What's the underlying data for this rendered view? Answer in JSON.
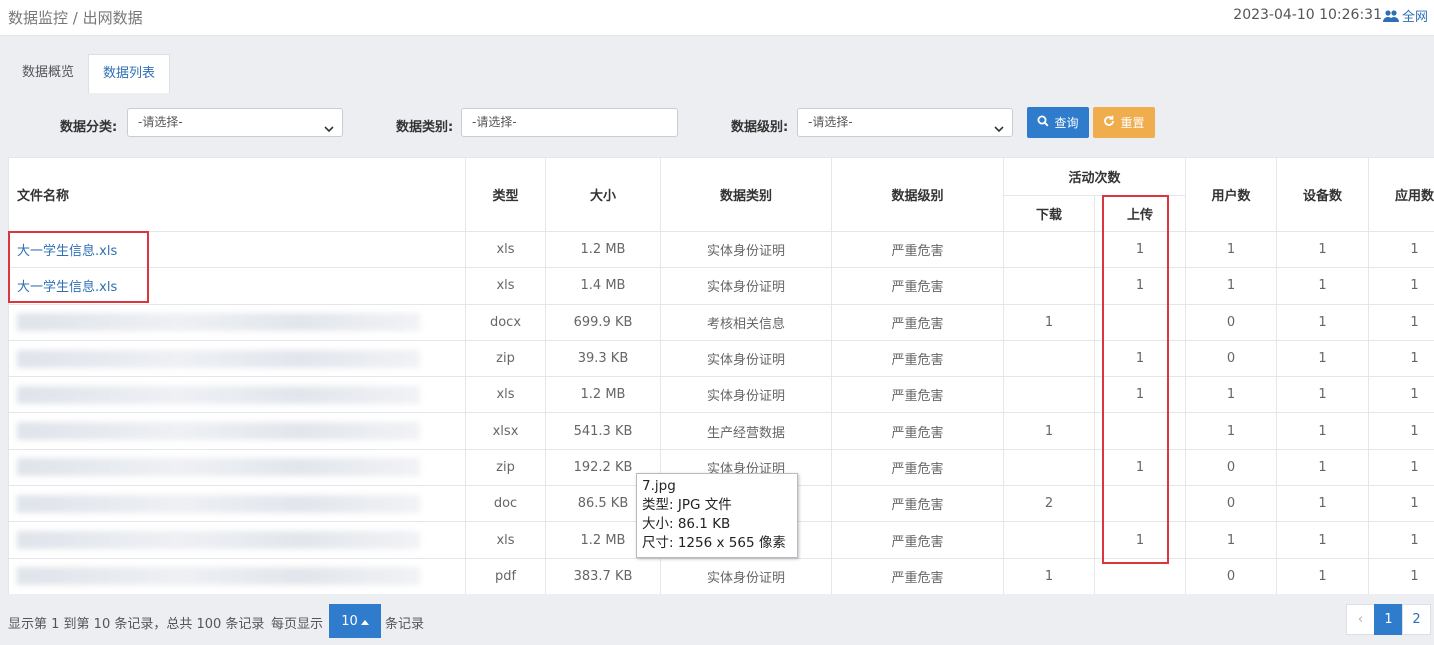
{
  "header": {
    "breadcrumb": "数据监控 / 出网数据",
    "datetime": "2023-04-10 10:26:31",
    "network_label": "全网",
    "network_icon": "users-icon"
  },
  "tabs": [
    {
      "label": "数据概览",
      "active": false
    },
    {
      "label": "数据列表",
      "active": true
    }
  ],
  "filters": {
    "category_label": "数据分类:",
    "category_value": "-请选择-",
    "type_label": "数据类别:",
    "type_placeholder": "-请选择-",
    "level_label": "数据级别:",
    "level_value": "-请选择-",
    "search_label": "查询",
    "reset_label": "重置"
  },
  "table": {
    "headers": {
      "filename": "文件名称",
      "type": "类型",
      "size": "大小",
      "data_category": "数据类别",
      "data_level": "数据级别",
      "activity": "活动次数",
      "download": "下载",
      "upload": "上传",
      "users": "用户数",
      "devices": "设备数",
      "apps": "应用数"
    },
    "rows": [
      {
        "name": "大一学生信息.xls",
        "blurred": false,
        "type": "xls",
        "size": "1.2 MB",
        "category": "实体身份证明",
        "level": "严重危害",
        "download": "",
        "upload": "1",
        "users": "1",
        "devices": "1",
        "apps": "1"
      },
      {
        "name": "大一学生信息.xls",
        "blurred": false,
        "type": "xls",
        "size": "1.4 MB",
        "category": "实体身份证明",
        "level": "严重危害",
        "download": "",
        "upload": "1",
        "users": "1",
        "devices": "1",
        "apps": "1"
      },
      {
        "name": "",
        "blurred": true,
        "type": "docx",
        "size": "699.9 KB",
        "category": "考核相关信息",
        "level": "严重危害",
        "download": "1",
        "upload": "",
        "users": "0",
        "devices": "1",
        "apps": "1"
      },
      {
        "name": "",
        "blurred": true,
        "type": "zip",
        "size": "39.3 KB",
        "category": "实体身份证明",
        "level": "严重危害",
        "download": "",
        "upload": "1",
        "users": "0",
        "devices": "1",
        "apps": "1"
      },
      {
        "name": "",
        "blurred": true,
        "type": "xls",
        "size": "1.2 MB",
        "category": "实体身份证明",
        "level": "严重危害",
        "download": "",
        "upload": "1",
        "users": "1",
        "devices": "1",
        "apps": "1"
      },
      {
        "name": "",
        "blurred": true,
        "type": "xlsx",
        "size": "541.3 KB",
        "category": "生产经营数据",
        "level": "严重危害",
        "download": "1",
        "upload": "",
        "users": "1",
        "devices": "1",
        "apps": "1"
      },
      {
        "name": "",
        "blurred": true,
        "type": "zip",
        "size": "192.2 KB",
        "category": "实体身份证明",
        "level": "严重危害",
        "download": "",
        "upload": "1",
        "users": "0",
        "devices": "1",
        "apps": "1"
      },
      {
        "name": "",
        "blurred": true,
        "type": "doc",
        "size": "86.5 KB",
        "category": "",
        "level": "严重危害",
        "download": "2",
        "upload": "",
        "users": "0",
        "devices": "1",
        "apps": "1"
      },
      {
        "name": "",
        "blurred": true,
        "type": "xls",
        "size": "1.2 MB",
        "category": "",
        "level": "严重危害",
        "download": "",
        "upload": "1",
        "users": "1",
        "devices": "1",
        "apps": "1"
      },
      {
        "name": "",
        "blurred": true,
        "type": "pdf",
        "size": "383.7 KB",
        "category": "实体身份证明",
        "level": "严重危害",
        "download": "1",
        "upload": "",
        "users": "0",
        "devices": "1",
        "apps": "1"
      }
    ]
  },
  "tooltip": {
    "line1": "7.jpg",
    "line2": "类型: JPG 文件",
    "line3": "大小: 86.1 KB",
    "line4": "尺寸: 1256 x 565 像素"
  },
  "footer": {
    "summary": "显示第 1 到第 10 条记录，总共 100 条记录",
    "per_page_prefix": "每页显示",
    "per_page_value": "10",
    "per_page_suffix": "条记录",
    "pages": [
      "‹",
      "1",
      "2"
    ],
    "active_page": "1"
  },
  "colors": {
    "accent": "#2f7bcc",
    "link": "#2f6fb5",
    "reset": "#f0ad4e",
    "highlight_box": "#d9363e"
  }
}
